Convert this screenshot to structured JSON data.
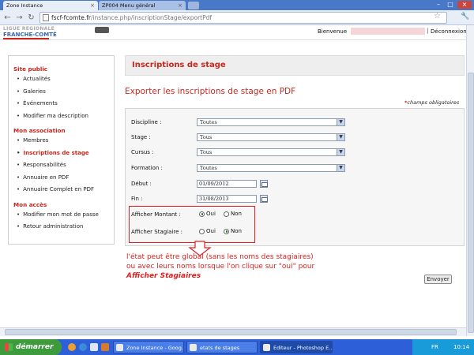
{
  "browser": {
    "tabs": [
      {
        "label": "Zone Instance",
        "active": true
      },
      {
        "label": "ZP004 Menu général",
        "active": false
      }
    ],
    "url": {
      "host": "fscf-fcomte.fr",
      "path": "/instance.php/inscriptionStage/exportPdf"
    }
  },
  "header": {
    "logo_line1": "LIGUE REGIONALE",
    "logo_line2": "FRANCHE-COMTÉ",
    "bienvenue": "Bienvenue",
    "separator": "|",
    "deconnexion": "Déconnexion"
  },
  "nav": {
    "sections": [
      {
        "title": "Site public",
        "items": [
          "Actualités",
          "Galeries",
          "Événements",
          "Modifier ma description"
        ]
      },
      {
        "title": "Mon association",
        "items": [
          "Membres",
          "Inscriptions de stage",
          "Responsabilités",
          "Annuaire en PDF",
          "Annuaire Complet en PDF"
        ]
      },
      {
        "title": "Mon accès",
        "items": [
          "Modifier mon mot de passe",
          "Retour administration"
        ]
      }
    ],
    "active_item": "Inscriptions de stage"
  },
  "main": {
    "heading": "Inscriptions de stage",
    "subtitle": "Exporter les inscriptions de stage en PDF",
    "required_mark": "*",
    "required_text": "champs obligatoires",
    "fields": {
      "discipline": {
        "label": "Discipline :",
        "value": "Toutes"
      },
      "stage": {
        "label": "Stage :",
        "value": "Tous"
      },
      "cursus": {
        "label": "Cursus :",
        "value": "Tous"
      },
      "formation": {
        "label": "Formation :",
        "value": "Toutes"
      },
      "debut": {
        "label": "Début :",
        "value": "01/09/2012"
      },
      "fin": {
        "label": "Fin :",
        "value": "31/08/2013"
      }
    },
    "radios": {
      "montant": {
        "label": "Afficher Montant :",
        "oui": "Oui",
        "non": "Non",
        "selected": "Oui"
      },
      "stagiaire": {
        "label": "Afficher Stagiaire :",
        "oui": "Oui",
        "non": "Non",
        "selected": "Non"
      }
    },
    "note_text": "l'état peut être global (sans les noms des stagiaires) ou avec leurs noms lorsque l'on clique sur \"oui\" pour ",
    "note_emphasis": "Afficher Stagiaires",
    "submit_label": "Envoyer"
  },
  "taskbar": {
    "start_label": "démarrer",
    "tasks": [
      {
        "label": "Zone Instance - Goog...",
        "active": false
      },
      {
        "label": "etats de stages",
        "active": false
      },
      {
        "label": "Editeur - Photoshop E...",
        "active": true
      }
    ],
    "language": "FR",
    "clock": "10:14"
  },
  "colors": {
    "accent": "#c8271d",
    "annotation": "#e02020",
    "taskbar": "#2d5fd8",
    "start": "#3d9b3d"
  }
}
